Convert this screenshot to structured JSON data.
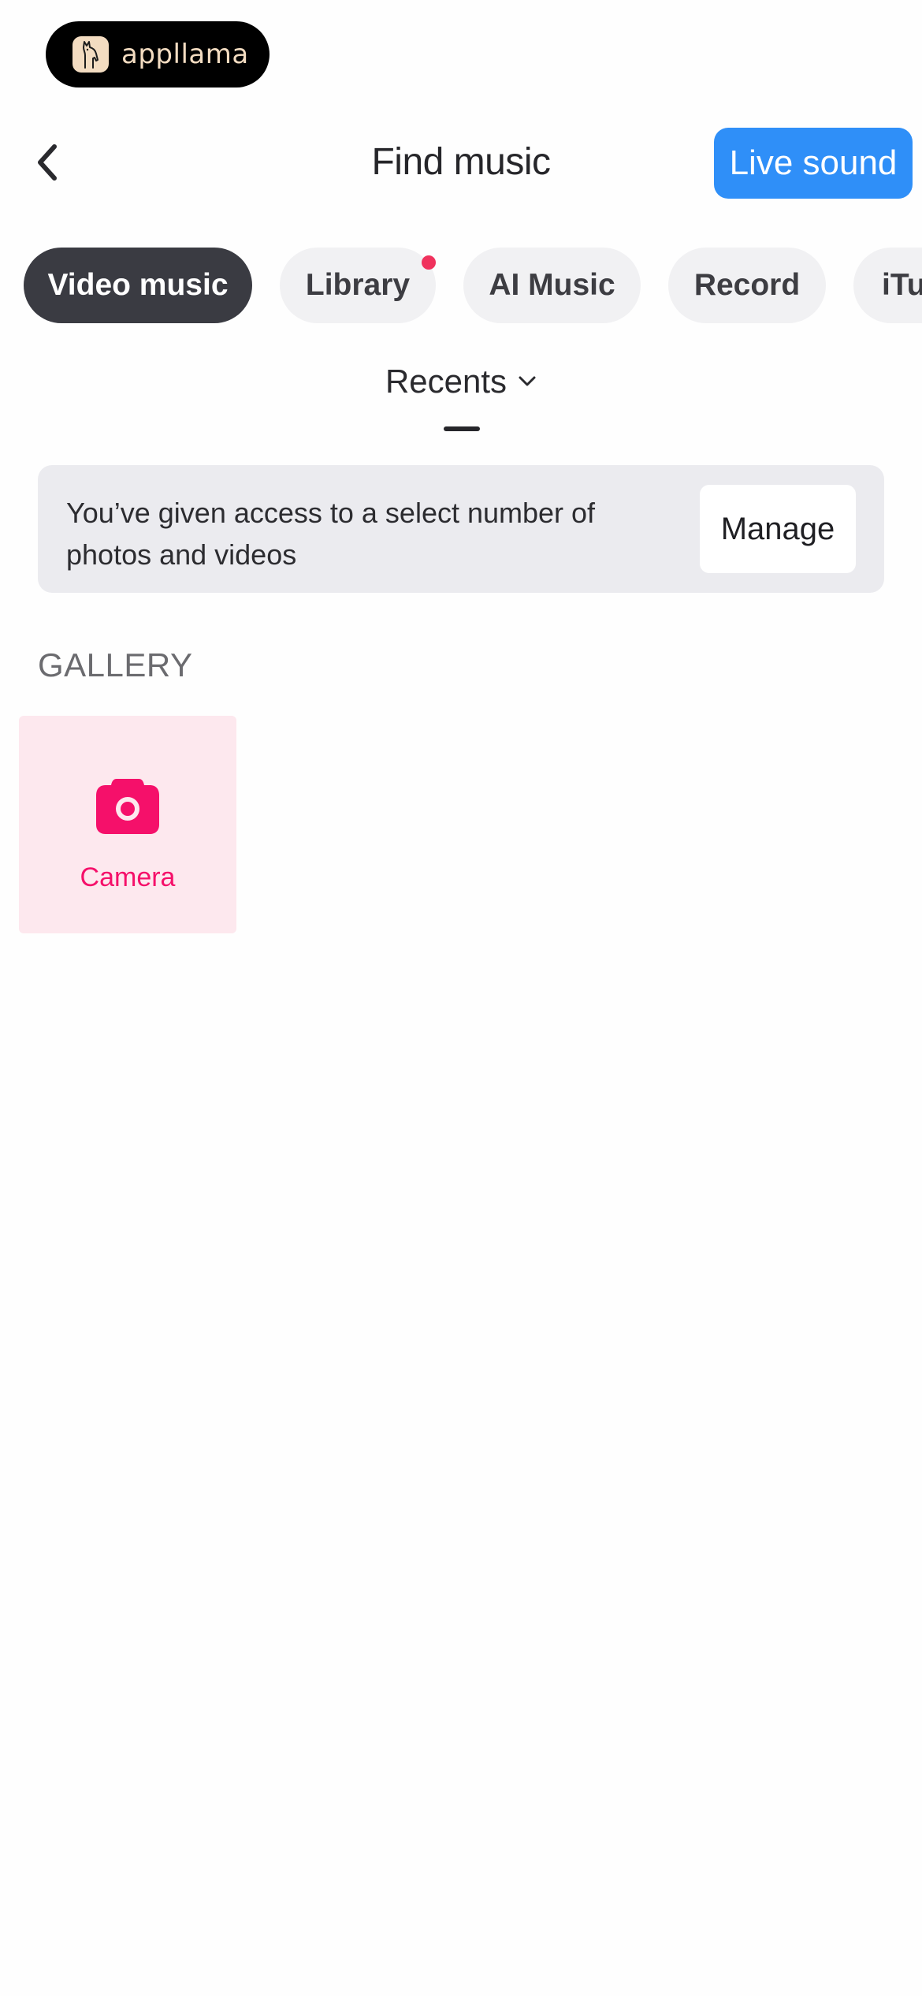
{
  "brand": {
    "name": "appllama",
    "logo_icon": "llama-logo-icon"
  },
  "header": {
    "back_icon": "chevron-left-icon",
    "title": "Find music",
    "live_sound_label": "Live sound"
  },
  "tabs": [
    {
      "label": "Video music",
      "active": true,
      "has_dot": false
    },
    {
      "label": "Library",
      "active": false,
      "has_dot": true
    },
    {
      "label": "AI Music",
      "active": false,
      "has_dot": false
    },
    {
      "label": "Record",
      "active": false,
      "has_dot": false
    },
    {
      "label": "iTu",
      "active": false,
      "has_dot": false
    }
  ],
  "album_selector": {
    "label": "Recents",
    "icon": "chevron-down-icon"
  },
  "access_banner": {
    "message": "You’ve given access to a select number of photos and videos",
    "manage_label": "Manage"
  },
  "gallery": {
    "heading": "GALLERY",
    "tiles": [
      {
        "label": "Camera",
        "icon": "camera-icon"
      }
    ]
  },
  "colors": {
    "accent_blue": "#2f8ff8",
    "active_tab": "#3a3b42",
    "notification_dot": "#f0325d",
    "camera_pink": "#f5106a",
    "camera_tile_bg": "#fde8ee",
    "banner_bg": "#ebebef"
  }
}
